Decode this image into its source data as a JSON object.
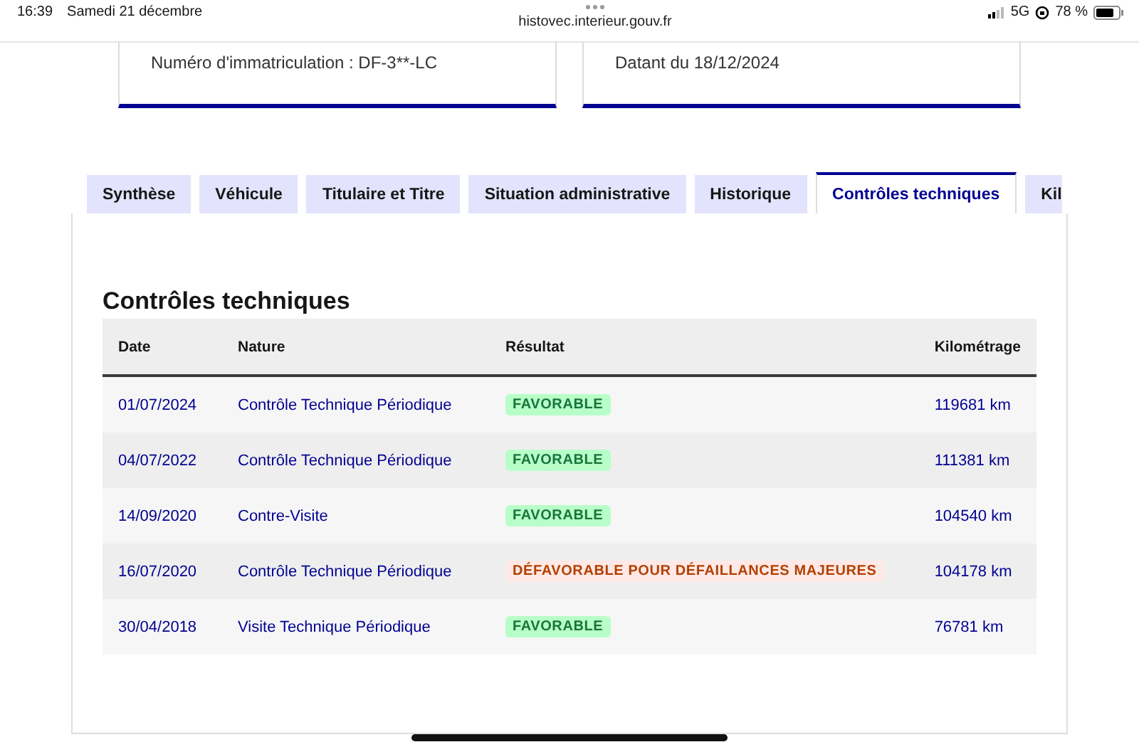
{
  "status_bar": {
    "time": "16:39",
    "date": "Samedi 21 décembre",
    "url": "histovec.interieur.gouv.fr",
    "network": "5G",
    "battery": "78 %"
  },
  "info_cards": [
    "Numéro d'immatriculation : DF-3**-LC",
    "Datant du 18/12/2024"
  ],
  "tabs": [
    {
      "label": "Synthèse",
      "selected": false
    },
    {
      "label": "Véhicule",
      "selected": false
    },
    {
      "label": "Titulaire et Titre",
      "selected": false
    },
    {
      "label": "Situation administrative",
      "selected": false
    },
    {
      "label": "Historique",
      "selected": false
    },
    {
      "label": "Contrôles techniques",
      "selected": true
    },
    {
      "label": "Kil",
      "selected": false
    }
  ],
  "section_title": "Contrôles techniques",
  "table": {
    "columns": [
      "Date",
      "Nature",
      "Résultat",
      "Kilométrage"
    ],
    "rows": [
      {
        "date": "01/07/2024",
        "nature": "Contrôle Technique Périodique",
        "result": "FAVORABLE",
        "kind": "favorable",
        "mileage": "119681 km"
      },
      {
        "date": "04/07/2022",
        "nature": "Contrôle Technique Périodique",
        "result": "FAVORABLE",
        "kind": "favorable",
        "mileage": "111381 km"
      },
      {
        "date": "14/09/2020",
        "nature": "Contre-Visite",
        "result": "FAVORABLE",
        "kind": "favorable",
        "mileage": "104540 km"
      },
      {
        "date": "16/07/2020",
        "nature": "Contrôle Technique Périodique",
        "result": "DÉFAVORABLE POUR DÉFAILLANCES MAJEURES",
        "kind": "unfavorable",
        "mileage": "104178 km"
      },
      {
        "date": "30/04/2018",
        "nature": "Visite Technique Périodique",
        "result": "FAVORABLE",
        "kind": "favorable",
        "mileage": "76781 km"
      }
    ]
  }
}
